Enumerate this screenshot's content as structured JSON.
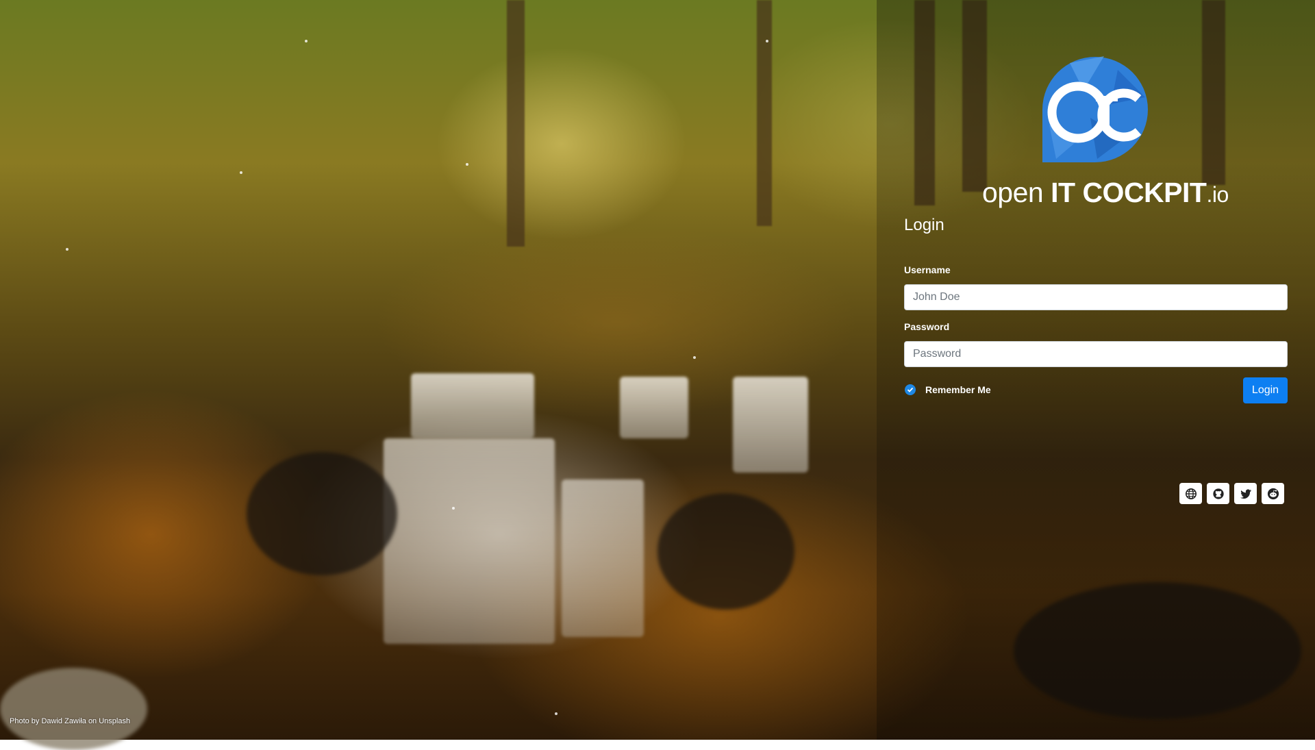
{
  "brand": {
    "logo_text_open": "open",
    "logo_text_it_cockpit": "IT COCKPIT",
    "logo_text_io": ".io",
    "logo_mark": "OITC"
  },
  "login_form": {
    "heading": "Login",
    "username_label": "Username",
    "username_placeholder": "John Doe",
    "password_label": "Password",
    "password_placeholder": "Password",
    "remember_me_label": "Remember Me",
    "remember_me_checked": true,
    "submit_label": "Login"
  },
  "social_links": [
    {
      "name": "website",
      "icon": "globe-icon"
    },
    {
      "name": "github",
      "icon": "github-icon"
    },
    {
      "name": "twitter",
      "icon": "twitter-icon"
    },
    {
      "name": "reddit",
      "icon": "reddit-icon"
    }
  ],
  "photo_credit": "Photo by Dawid Zawiła on Unsplash",
  "colors": {
    "primary": "#0d7ff2",
    "checkbox": "#1e88e5",
    "logo_blue": "#2f7fd8"
  }
}
